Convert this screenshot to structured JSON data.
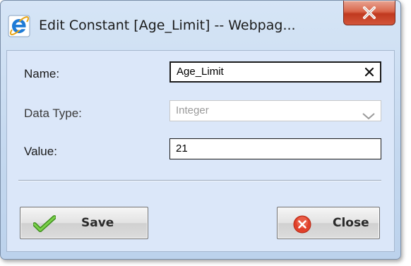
{
  "window": {
    "title": "Edit Constant [Age_Limit] -- Webpag...",
    "title_icon": "internet-explorer-icon",
    "close_icon": "close-icon"
  },
  "form": {
    "name_label": "Name:",
    "name_value": "Age_Limit",
    "data_type_label": "Data Type:",
    "data_type_value": "Integer",
    "value_label": "Value:",
    "value_value": "21"
  },
  "buttons": {
    "save_label": "Save",
    "save_icon": "checkmark-icon",
    "close_label": "Close",
    "close_icon": "red-x-circle-icon"
  },
  "colors": {
    "window_frame": "#c4d8ef",
    "client_bg": "#dbe7f9",
    "close_button": "#c0391f",
    "save_check": "#5bb02f",
    "close_circle": "#e0402a"
  }
}
